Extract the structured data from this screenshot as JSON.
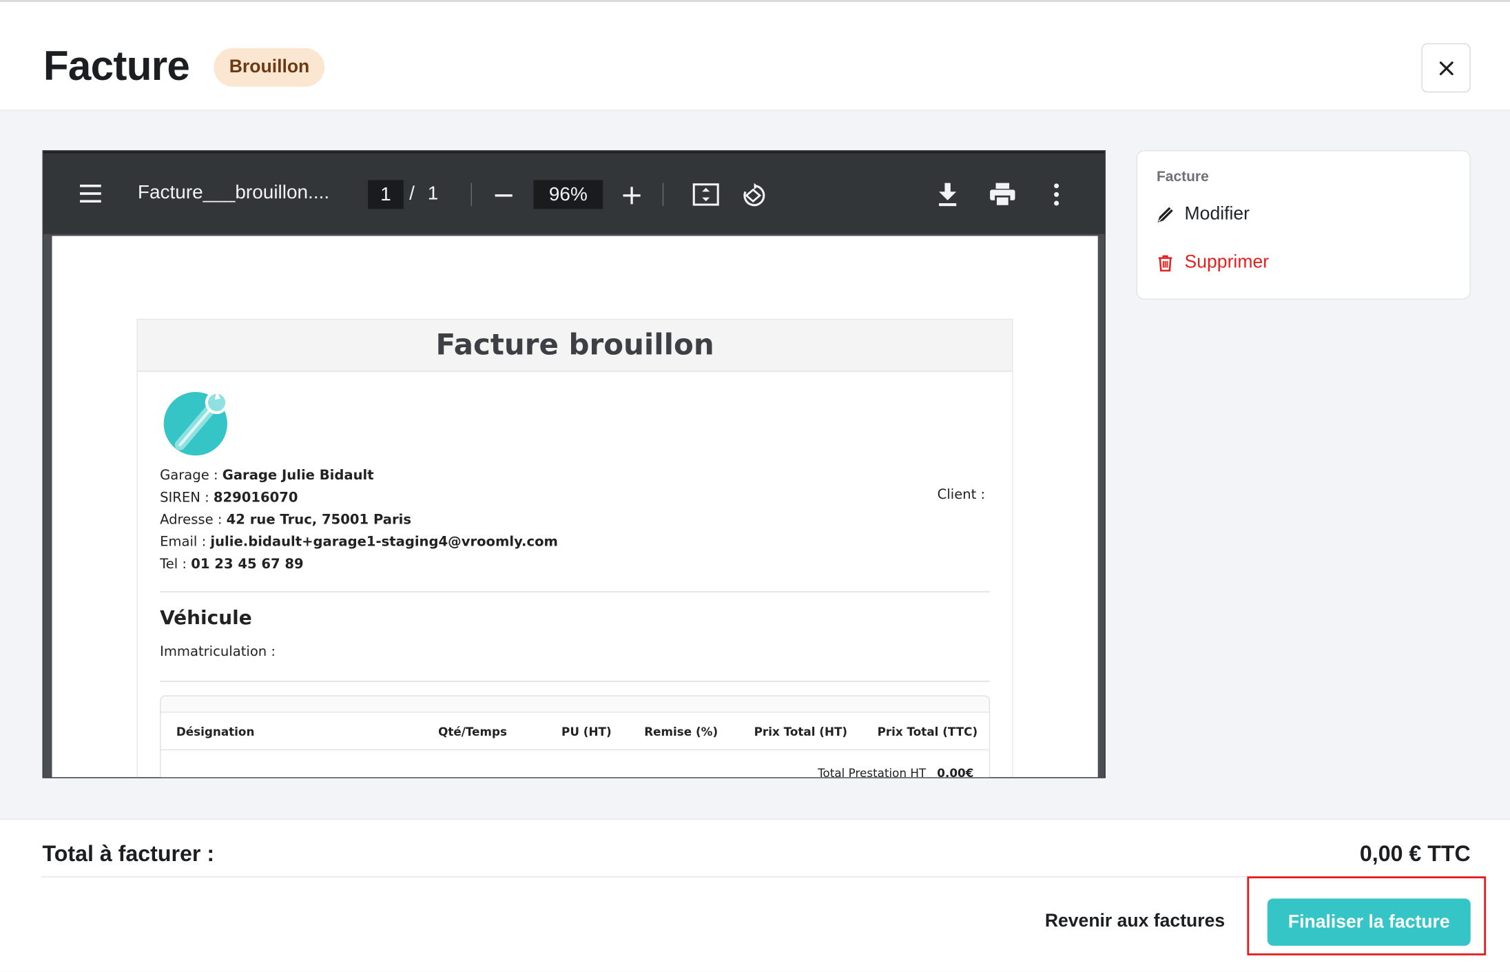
{
  "header": {
    "title": "Facture",
    "status_badge": "Brouillon"
  },
  "pdf_viewer": {
    "filename": "Facture___brouillon....",
    "current_page": "1",
    "page_separator": "/",
    "total_pages": "1",
    "zoom": "96%"
  },
  "document": {
    "title": "Facture brouillon",
    "garage_label": "Garage :",
    "garage_value": "Garage Julie Bidault",
    "siren_label": "SIREN :",
    "siren_value": "829016070",
    "address_label": "Adresse :",
    "address_value": "42 rue Truc, 75001 Paris",
    "email_label": "Email :",
    "email_value": "julie.bidault+garage1-staging4@vroomly.com",
    "tel_label": "Tel :",
    "tel_value": "01 23 45 67 89",
    "client_label": "Client :",
    "vehicle_heading": "Véhicule",
    "immat_label": "Immatriculation :",
    "table_headers": [
      "Désignation",
      "Qté/Temps",
      "PU (HT)",
      "Remise (%)",
      "Prix Total (HT)",
      "Prix Total (TTC)"
    ],
    "total_prestation_label": "Total Prestation HT",
    "total_prestation_value": "0,00€"
  },
  "side_menu": {
    "title": "Facture",
    "edit_label": "Modifier",
    "delete_label": "Supprimer"
  },
  "footer": {
    "total_label": "Total à facturer :",
    "total_value": "0,00 € TTC",
    "back_label": "Revenir aux factures",
    "finalize_label": "Finaliser la facture"
  },
  "colors": {
    "accent": "#36c5c6",
    "danger": "#e3211f",
    "badge_bg": "#fbe6d2"
  }
}
